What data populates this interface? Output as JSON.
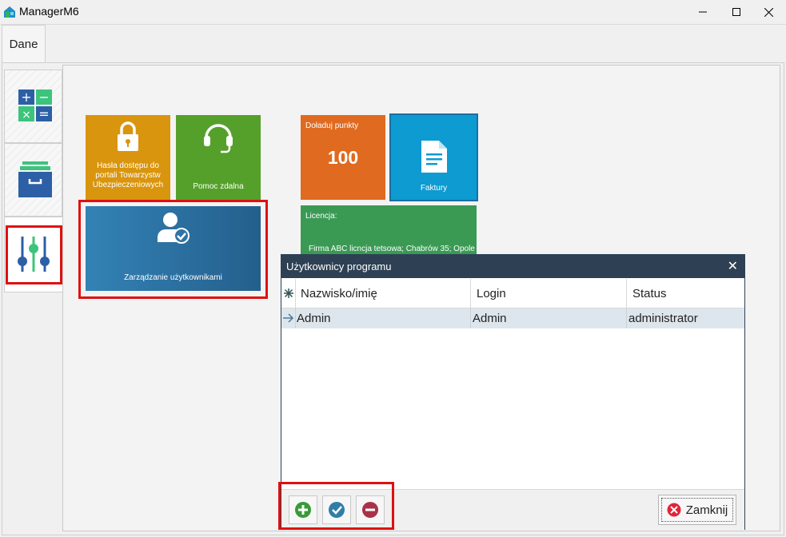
{
  "window": {
    "title": "ManagerM6"
  },
  "tabs": [
    {
      "label": "Dane"
    }
  ],
  "tiles": {
    "hasla": {
      "label": "Hasła dostępu do portali Towarzystw Ubezpieczeniowych",
      "color": "#d9950e"
    },
    "pomoc": {
      "label": "Pomoc zdalna",
      "color": "#55a02a"
    },
    "doladuj": {
      "label": "Doładuj punkty",
      "value": "100",
      "color": "#e06a1f"
    },
    "faktury": {
      "label": "Faktury",
      "color": "#0d9bd1"
    },
    "licencja": {
      "label": "Licencja:",
      "text": "Firma ABC licncja tetsowa; Chabrów 35; Opole",
      "color": "#3a9a54"
    },
    "users": {
      "label": "Zarządzanie użytkownikami",
      "color": "#2e74a4"
    }
  },
  "dialog": {
    "title": "Użytkownicy programu",
    "columns": [
      "Nazwisko/imię",
      "Login",
      "Status"
    ],
    "rows": [
      {
        "name": "Admin",
        "login": "Admin",
        "status": "administrator"
      }
    ],
    "close_label": "Zamknij"
  }
}
